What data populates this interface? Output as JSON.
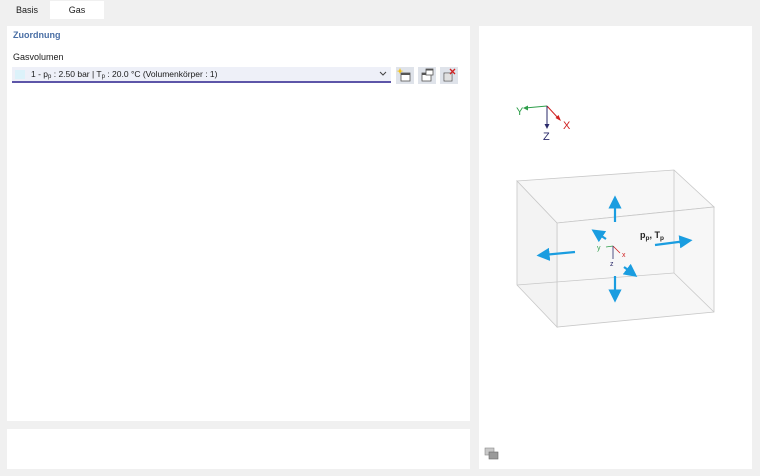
{
  "tabs": [
    {
      "label": "Basis"
    },
    {
      "label": "Gas",
      "active": true
    }
  ],
  "section": {
    "title": "Zuordnung"
  },
  "gas_volume": {
    "label": "Gasvolumen",
    "selected": {
      "prefix": "1 - p",
      "p_sub": "p",
      "p_value": " : 2.50 bar | T",
      "t_sub": "p",
      "t_value": " : 20.0 °C (Volumenkörper : 1)"
    },
    "swatch_color": "#dcf2fa"
  },
  "toolbar_icons": [
    "new-gas-volume-icon",
    "edit-gas-volume-icon",
    "delete-gas-volume-icon"
  ],
  "axes": {
    "y": "Y",
    "x": "X",
    "z": "Z"
  },
  "local_axes": {
    "y": "y",
    "x": "x",
    "z": "z"
  },
  "pressure_label": {
    "p": "p",
    "p_sub": "p",
    "sep": ", ",
    "t": "T",
    "t_sub": "p"
  },
  "accent_colors": {
    "arrow": "#1a9de0",
    "axis_y": "#2e9e4a",
    "axis_x": "#d02020",
    "axis_z": "#2a2a6a",
    "combo_underline": "#5d55a8"
  }
}
